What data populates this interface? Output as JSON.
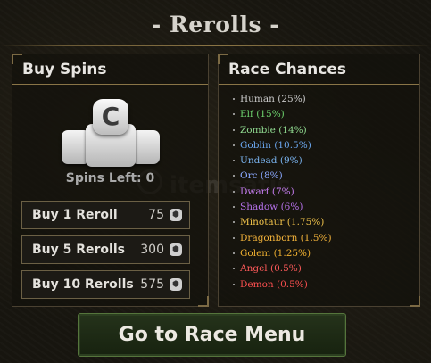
{
  "title": "- Rerolls -",
  "buy": {
    "heading": "Buy Spins",
    "coin_glyph": "C",
    "spins_left": "Spins Left: 0",
    "currency_icon": "robux-icon",
    "options": [
      {
        "label": "Buy 1 Reroll",
        "price": "75"
      },
      {
        "label": "Buy 5 Rerolls",
        "price": "300"
      },
      {
        "label": "Buy 10 Rerolls",
        "price": "575"
      }
    ]
  },
  "races": {
    "heading": "Race Chances",
    "items": [
      {
        "text": "Human (25%)",
        "color": "#c9c9c9"
      },
      {
        "text": "Elf (15%)",
        "color": "#6fd66f"
      },
      {
        "text": "Zombie (14%)",
        "color": "#8fd88f"
      },
      {
        "text": "Goblin (10.5%)",
        "color": "#6aa6ee"
      },
      {
        "text": "Undead (9%)",
        "color": "#7ab4f0"
      },
      {
        "text": "Orc (8%)",
        "color": "#8aa8ff"
      },
      {
        "text": "Dwarf (7%)",
        "color": "#c57cf0"
      },
      {
        "text": "Shadow (6%)",
        "color": "#b873ee"
      },
      {
        "text": "Minotaur (1.75%)",
        "color": "#f0c24a"
      },
      {
        "text": "Dragonborn (1.5%)",
        "color": "#f2b23a"
      },
      {
        "text": "Golem (1.25%)",
        "color": "#f0b030"
      },
      {
        "text": "Angel (0.5%)",
        "color": "#ff5a5a"
      },
      {
        "text": "Demon (0.5%)",
        "color": "#ff5050"
      }
    ]
  },
  "go_button": "Go to Race Menu",
  "watermark": "itemsatis"
}
